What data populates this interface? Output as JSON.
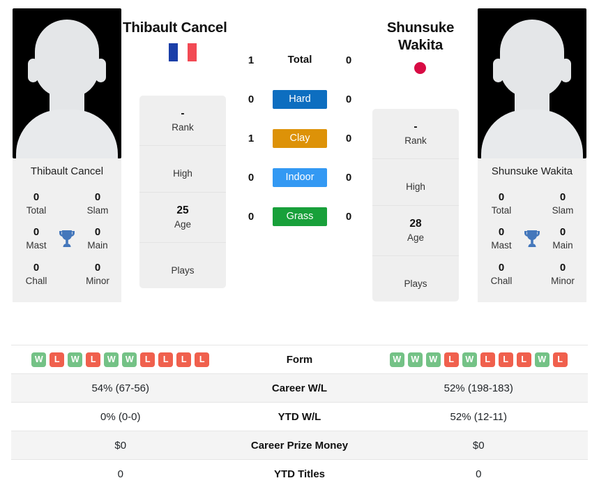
{
  "players": {
    "left": {
      "name": "Thibault Cancel",
      "photo_caption": "Thibault Cancel",
      "flag": "france-flag",
      "titles": [
        {
          "value": "0",
          "label": "Total"
        },
        {
          "value": "0",
          "label": "Slam"
        },
        {
          "value": "0",
          "label": "Mast"
        },
        {
          "value": "0",
          "label": "Main"
        },
        {
          "value": "0",
          "label": "Chall"
        },
        {
          "value": "0",
          "label": "Minor"
        }
      ],
      "info": [
        {
          "value": "-",
          "label": "Rank"
        },
        {
          "value": "",
          "label": "High"
        },
        {
          "value": "25",
          "label": "Age"
        },
        {
          "value": "",
          "label": "Plays"
        }
      ],
      "form": [
        "W",
        "L",
        "W",
        "L",
        "W",
        "W",
        "L",
        "L",
        "L",
        "L"
      ],
      "career_wl": "54% (67-56)",
      "ytd_wl": "0% (0-0)",
      "career_prize_money": "$0",
      "ytd_titles": "0"
    },
    "right": {
      "name": "Shunsuke Wakita",
      "photo_caption": "Shunsuke Wakita",
      "flag": "japan-flag",
      "titles": [
        {
          "value": "0",
          "label": "Total"
        },
        {
          "value": "0",
          "label": "Slam"
        },
        {
          "value": "0",
          "label": "Mast"
        },
        {
          "value": "0",
          "label": "Main"
        },
        {
          "value": "0",
          "label": "Chall"
        },
        {
          "value": "0",
          "label": "Minor"
        }
      ],
      "info": [
        {
          "value": "-",
          "label": "Rank"
        },
        {
          "value": "",
          "label": "High"
        },
        {
          "value": "28",
          "label": "Age"
        },
        {
          "value": "",
          "label": "Plays"
        }
      ],
      "form": [
        "W",
        "W",
        "W",
        "L",
        "W",
        "L",
        "L",
        "L",
        "W",
        "L"
      ],
      "career_wl": "52% (198-183)",
      "ytd_wl": "52% (12-11)",
      "career_prize_money": "$0",
      "ytd_titles": "0"
    }
  },
  "head_to_head": [
    {
      "label": "Total",
      "left": "1",
      "right": "0",
      "type": "total",
      "color": ""
    },
    {
      "label": "Hard",
      "left": "0",
      "right": "0",
      "type": "surface",
      "color": "#0d6ec0"
    },
    {
      "label": "Clay",
      "left": "1",
      "right": "0",
      "type": "surface",
      "color": "#dd9208"
    },
    {
      "label": "Indoor",
      "left": "0",
      "right": "0",
      "type": "surface",
      "color": "#3399f3"
    },
    {
      "label": "Grass",
      "left": "0",
      "right": "0",
      "type": "surface",
      "color": "#18a03a"
    }
  ],
  "table": {
    "rows": [
      {
        "label": "Form",
        "key": "form",
        "alt": false
      },
      {
        "label": "Career W/L",
        "key": "career_wl",
        "alt": true
      },
      {
        "label": "YTD W/L",
        "key": "ytd_wl",
        "alt": false
      },
      {
        "label": "Career Prize Money",
        "key": "career_prize_money",
        "alt": true
      },
      {
        "label": "YTD Titles",
        "key": "ytd_titles",
        "alt": false
      }
    ]
  },
  "colors": {
    "win": "#74c286",
    "loss": "#f0604d",
    "hard": "#0d6ec0",
    "clay": "#dd9208",
    "indoor": "#3399f3",
    "grass": "#18a03a",
    "trophy": "#4477bb",
    "card_bg": "#efefef",
    "row_alt": "#f4f4f4"
  }
}
